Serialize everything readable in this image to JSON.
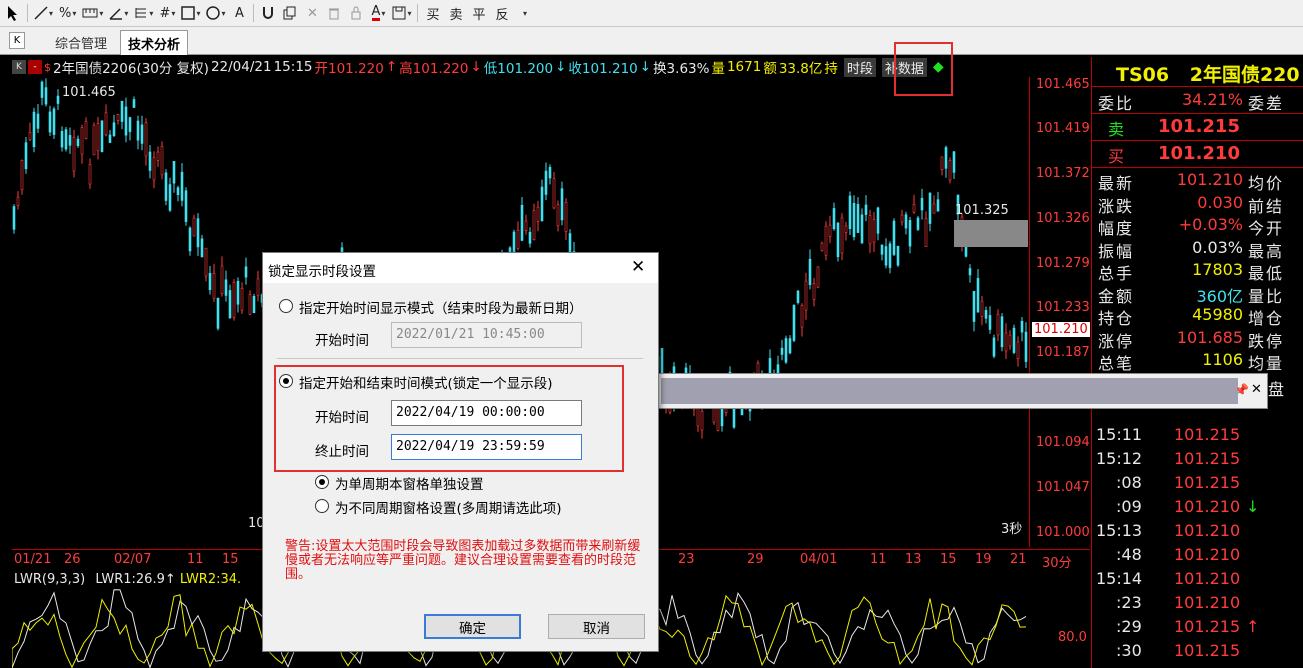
{
  "toolbar": {
    "trade_labels": [
      "买",
      "卖",
      "平",
      "反"
    ]
  },
  "tabs": {
    "k_label": "K",
    "tab1": "综合管理",
    "tab2": "技术分析"
  },
  "chart_header": {
    "name": "2年国债2206(30分 复权)",
    "date": "22/04/21",
    "time": "15:15",
    "open": "开101.220",
    "high": "高101.220",
    "low": "低101.200",
    "close": "收101.210",
    "turnover": "换3.63%",
    "volume_label": "量",
    "volume": "1671",
    "amount_label": "额",
    "amount": "33.8亿",
    "btn_cut": "持",
    "btn_period": "时段",
    "btn_fill": "补数据"
  },
  "price_axis": [
    "101.465",
    "101.419",
    "101.372",
    "101.326",
    "101.279",
    "101.233",
    "101.187",
    "101.094",
    "101.047",
    "101.000"
  ],
  "current_price": "101.210",
  "chart_labels": {
    "max_label": "101.465",
    "mark_label": "101.325",
    "left_bottom_label": "10",
    "sec_label": "3秒"
  },
  "date_axis": [
    "01/21",
    "26",
    "02/07",
    "11",
    "15",
    "23",
    "29",
    "04/01",
    "11",
    "13",
    "15",
    "19",
    "21",
    "30分"
  ],
  "indicator": {
    "name": "LWR(9,3,3)",
    "lwr1": "LWR1:26.9",
    "lwr2": "LWR2:34.",
    "level": "80.0"
  },
  "quote_panel": {
    "code": "TS06",
    "name": "2年国债220",
    "weibi_label": "委比",
    "weibi_value": "34.21%",
    "weicha_label": "委差",
    "sell_label": "卖",
    "sell_price": "101.215",
    "buy_label": "买",
    "buy_price": "101.210",
    "rows": [
      {
        "label": "最新",
        "value": "101.210",
        "label2": "均价",
        "color": "#ff3c3c"
      },
      {
        "label": "涨跌",
        "value": "0.030",
        "label2": "前结",
        "color": "#ff3c3c"
      },
      {
        "label": "幅度",
        "value": "+0.03%",
        "label2": "今开",
        "color": "#ff3c3c"
      },
      {
        "label": "振幅",
        "value": "0.03%",
        "label2": "最高",
        "color": "#e8e8e8"
      },
      {
        "label": "总手",
        "value": "17803",
        "label2": "最低",
        "color": "#f0f000"
      },
      {
        "label": "金额",
        "value": "360亿",
        "label2": "量比",
        "color": "#40e0f0"
      },
      {
        "label": "持仓",
        "value": "45980",
        "label2": "增仓",
        "color": "#f0f000"
      },
      {
        "label": "涨停",
        "value": "101.685",
        "label2": "跌停",
        "color": "#ff3c3c"
      },
      {
        "label": "总笔",
        "value": "1106",
        "label2": "均量",
        "color": "#f0f000"
      }
    ],
    "ticks": [
      {
        "time": "15:11",
        "price": "101.215",
        "arrow": ""
      },
      {
        "time": "15:12",
        "price": "101.215",
        "arrow": ""
      },
      {
        "time": ":08",
        "price": "101.215",
        "arrow": ""
      },
      {
        "time": ":09",
        "price": "101.210",
        "arrow": "↓"
      },
      {
        "time": "15:13",
        "price": "101.210",
        "arrow": ""
      },
      {
        "time": ":48",
        "price": "101.210",
        "arrow": ""
      },
      {
        "time": "15:14",
        "price": "101.210",
        "arrow": ""
      },
      {
        "time": ":23",
        "price": "101.210",
        "arrow": ""
      },
      {
        "time": ":29",
        "price": "101.215",
        "arrow": "↑"
      },
      {
        "time": ":30",
        "price": "101.215",
        "arrow": ""
      }
    ],
    "partial_label": "盘"
  },
  "dialog": {
    "title": "锁定显示时段设置",
    "mode1_label": "指定开始时间显示模式（结束时段为最新日期）",
    "start_label_1": "开始时间",
    "start_value_1": "2022/01/21 10:45:00",
    "mode2_label": "指定开始和结束时间模式(锁定一个显示段)",
    "start_label_2": "开始时间",
    "start_value_2": "2022/04/19 00:00:00",
    "end_label": "终止时间",
    "end_value": "2022/04/19 23:59:59",
    "opt_single": "为单周期本窗格单独设置",
    "opt_multi": "为不同周期窗格设置(多周期请选此项)",
    "warning": "警告:设置太大范围时段会导致图表加载过多数据而带来刷新缓慢或者无法响应等严重问题。建议合理设置需要查看的时段范围。",
    "ok": "确定",
    "cancel": "取消"
  }
}
